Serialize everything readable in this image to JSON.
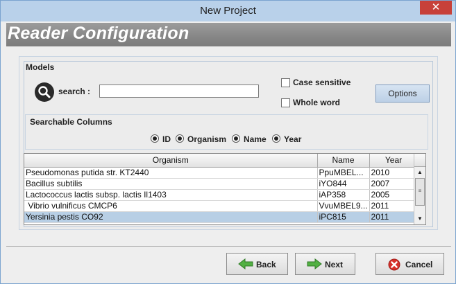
{
  "window": {
    "title": "New Project",
    "close_glyph": "✕"
  },
  "header": {
    "title": "Reader Configuration"
  },
  "models": {
    "label": "Models",
    "search_label": "search :",
    "search_value": "",
    "case_sensitive_label": "Case sensitive",
    "whole_word_label": "Whole word",
    "options_label": "Options"
  },
  "searchable_columns": {
    "label": "Searchable Columns",
    "options": [
      "ID",
      "Organism",
      "Name",
      "Year"
    ]
  },
  "table": {
    "columns": [
      "Organism",
      "Name",
      "Year"
    ],
    "rows": [
      {
        "organism": "Pseudomonas putida str. KT2440",
        "name": "PpuMBEL...",
        "year": "2010"
      },
      {
        "organism": "Bacillus subtilis",
        "name": "iYO844",
        "year": "2007"
      },
      {
        "organism": "Lactococcus lactis subsp. lactis Il1403",
        "name": "iAP358",
        "year": "2005"
      },
      {
        "organism": " Vibrio vulnificus CMCP6",
        "name": "VvuMBEL9...",
        "year": "2011"
      },
      {
        "organism": "Yersinia pestis CO92",
        "name": "iPC815",
        "year": "2011"
      }
    ],
    "selected_row": 4
  },
  "footer": {
    "back_label": "Back",
    "next_label": "Next",
    "cancel_label": "Cancel"
  },
  "colors": {
    "titlebar": "#b9d1ea",
    "close": "#c7413a",
    "selection": "#b8cfe5",
    "arrow_green": "#4caf3f",
    "cancel_red": "#d7302a"
  },
  "icons": {
    "search": "magnifier-icon",
    "back": "arrow-left-icon",
    "next": "arrow-right-icon",
    "cancel": "cancel-x-icon"
  }
}
